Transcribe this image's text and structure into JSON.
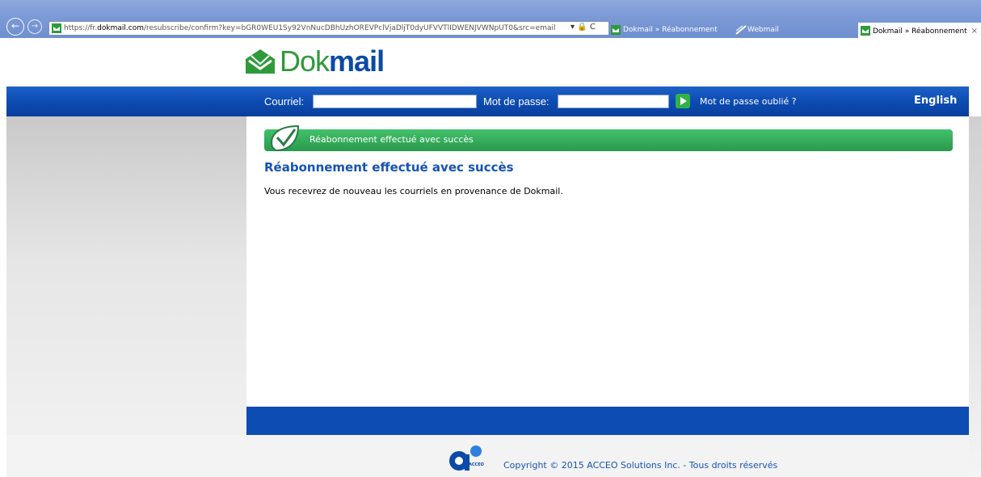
{
  "browser": {
    "address_url_prefix": "https://fr.",
    "address_url_host": "dokmail.com",
    "address_url_rest": "/resubscribe/confirm?key=bGR0WEU1Sy92VnNucDBhUzhOREVPclVjaDljT0dyUFVVTlIDWENJVWNpUT0&src=email",
    "address_icons": "▾ 🔒 C",
    "tabs": [
      {
        "label": "Dokmail » Réabonnement"
      },
      {
        "label": "Webmail"
      },
      {
        "label": "Dokmail » Réabonnement",
        "close": "×"
      }
    ],
    "back_icon": "←",
    "forward_icon": "→"
  },
  "logo": {
    "part1": "Dok",
    "part2": "mail"
  },
  "login": {
    "email_label": "Courriel:",
    "password_label": "Mot de passe:",
    "forgot_label": "Mot de passe oublié ?",
    "language_link": "English"
  },
  "content": {
    "banner_text": "Réabonnement effectué avec succès",
    "heading": "Réabonnement effectué avec succès",
    "message": "Vous recevrez de nouveau les courriels en provenance de Dokmail."
  },
  "footer": {
    "copyright": "Copyright © 2015 ACCEO Solutions Inc. - Tous droits réservés",
    "acceo_logo_text": "ACCEO"
  },
  "colors": {
    "brand_blue": "#0d4cb3",
    "brand_green": "#2e9a3a",
    "banner_green": "#3ab05e"
  }
}
